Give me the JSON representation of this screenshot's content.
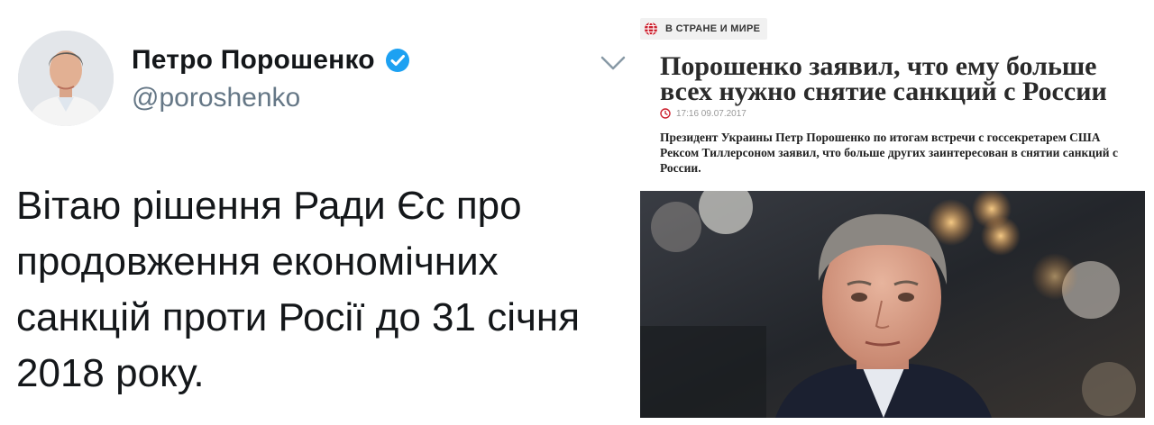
{
  "tweet": {
    "author_name": "Петро Порошенко",
    "handle": "@poroshenko",
    "text": "Вітаю рішення Ради Єс про продовження економічних санкцій проти Росії до 31 січня 2018 року.",
    "avatar_icon": "avatar-photo",
    "verified_icon": "verified-badge-icon",
    "menu_icon": "chevron-down-icon",
    "colors": {
      "verified": "#1da1f2",
      "handle": "#657786",
      "text": "#14171a"
    }
  },
  "article": {
    "category": "В СТРАНЕ И МИРЕ",
    "category_icon": "globe-icon",
    "headline": "Порошенко заявил, что ему больше всех нужно снятие санкций с России",
    "timestamp": "17:16 09.07.2017",
    "timestamp_icon": "clock-icon",
    "lead": "Президент Украины Петр Порошенко по итогам встречи с госсекретарем США Рексом Тиллерсоном заявил, что больше других заинтересован в снятии санкций с России.",
    "photo": "article-photo",
    "colors": {
      "accent": "#cc1f2d",
      "headline": "#2a2a2a"
    }
  }
}
